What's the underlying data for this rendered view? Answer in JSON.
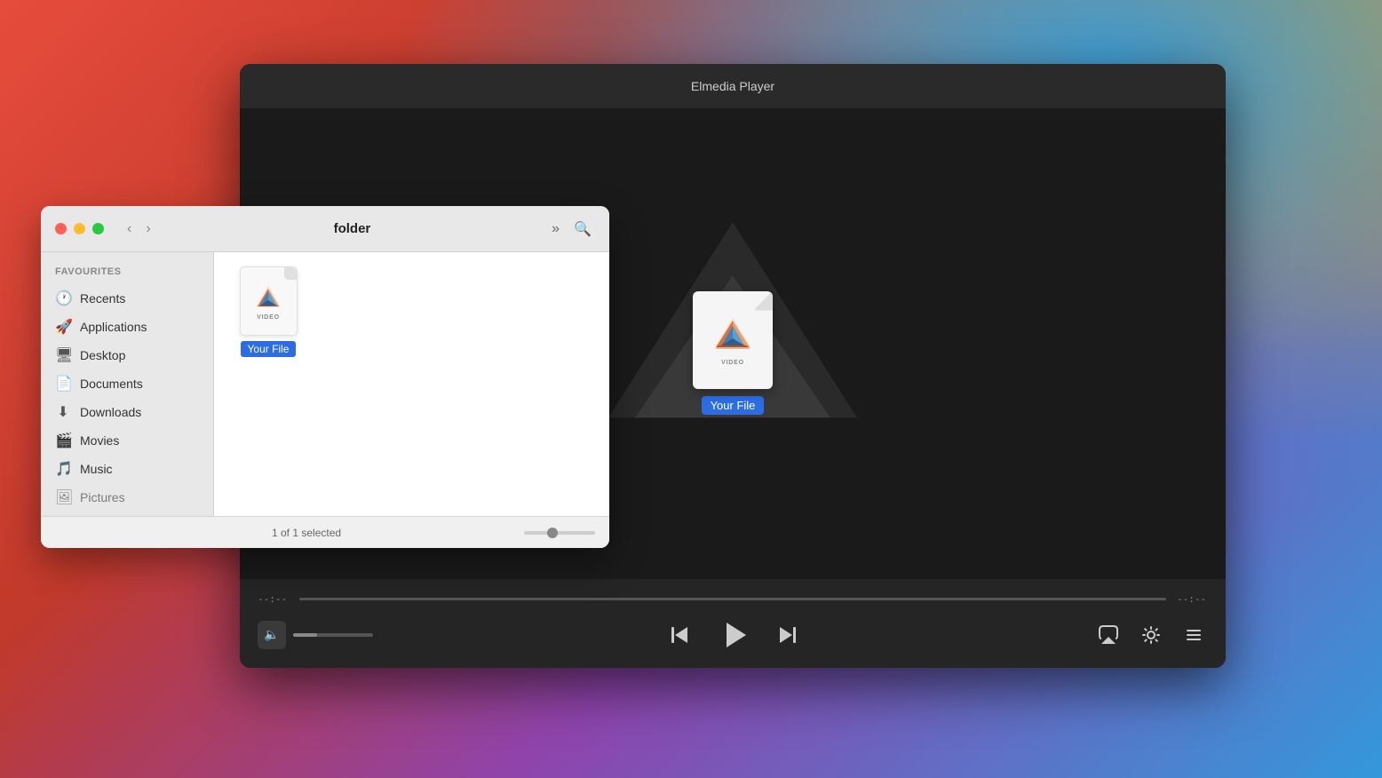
{
  "desktop": {
    "bg": "gradient"
  },
  "player_window": {
    "title": "Elmedia Player",
    "file_label": "Your File",
    "file_type": "VIDEO",
    "time_start": "--:--",
    "time_end": "--:--"
  },
  "finder_window": {
    "folder_name": "folder",
    "traffic_lights": [
      "red",
      "yellow",
      "green"
    ],
    "status_text": "1 of 1 selected",
    "sidebar": {
      "section_label": "Favourites",
      "items": [
        {
          "label": "Recents",
          "icon": "🕐"
        },
        {
          "label": "Applications",
          "icon": "🚀"
        },
        {
          "label": "Desktop",
          "icon": "🖥"
        },
        {
          "label": "Documents",
          "icon": "📄"
        },
        {
          "label": "Downloads",
          "icon": "⬇"
        },
        {
          "label": "Movies",
          "icon": "🎬"
        },
        {
          "label": "Music",
          "icon": "🎵"
        },
        {
          "label": "Pictures",
          "icon": "🖼"
        }
      ]
    },
    "file": {
      "name": "Your File",
      "type": "VIDEO"
    }
  },
  "controls": {
    "prev_label": "⏮",
    "play_label": "▶",
    "next_label": "⏭",
    "airplay_label": "airplay",
    "settings_label": "settings",
    "list_label": "list"
  }
}
